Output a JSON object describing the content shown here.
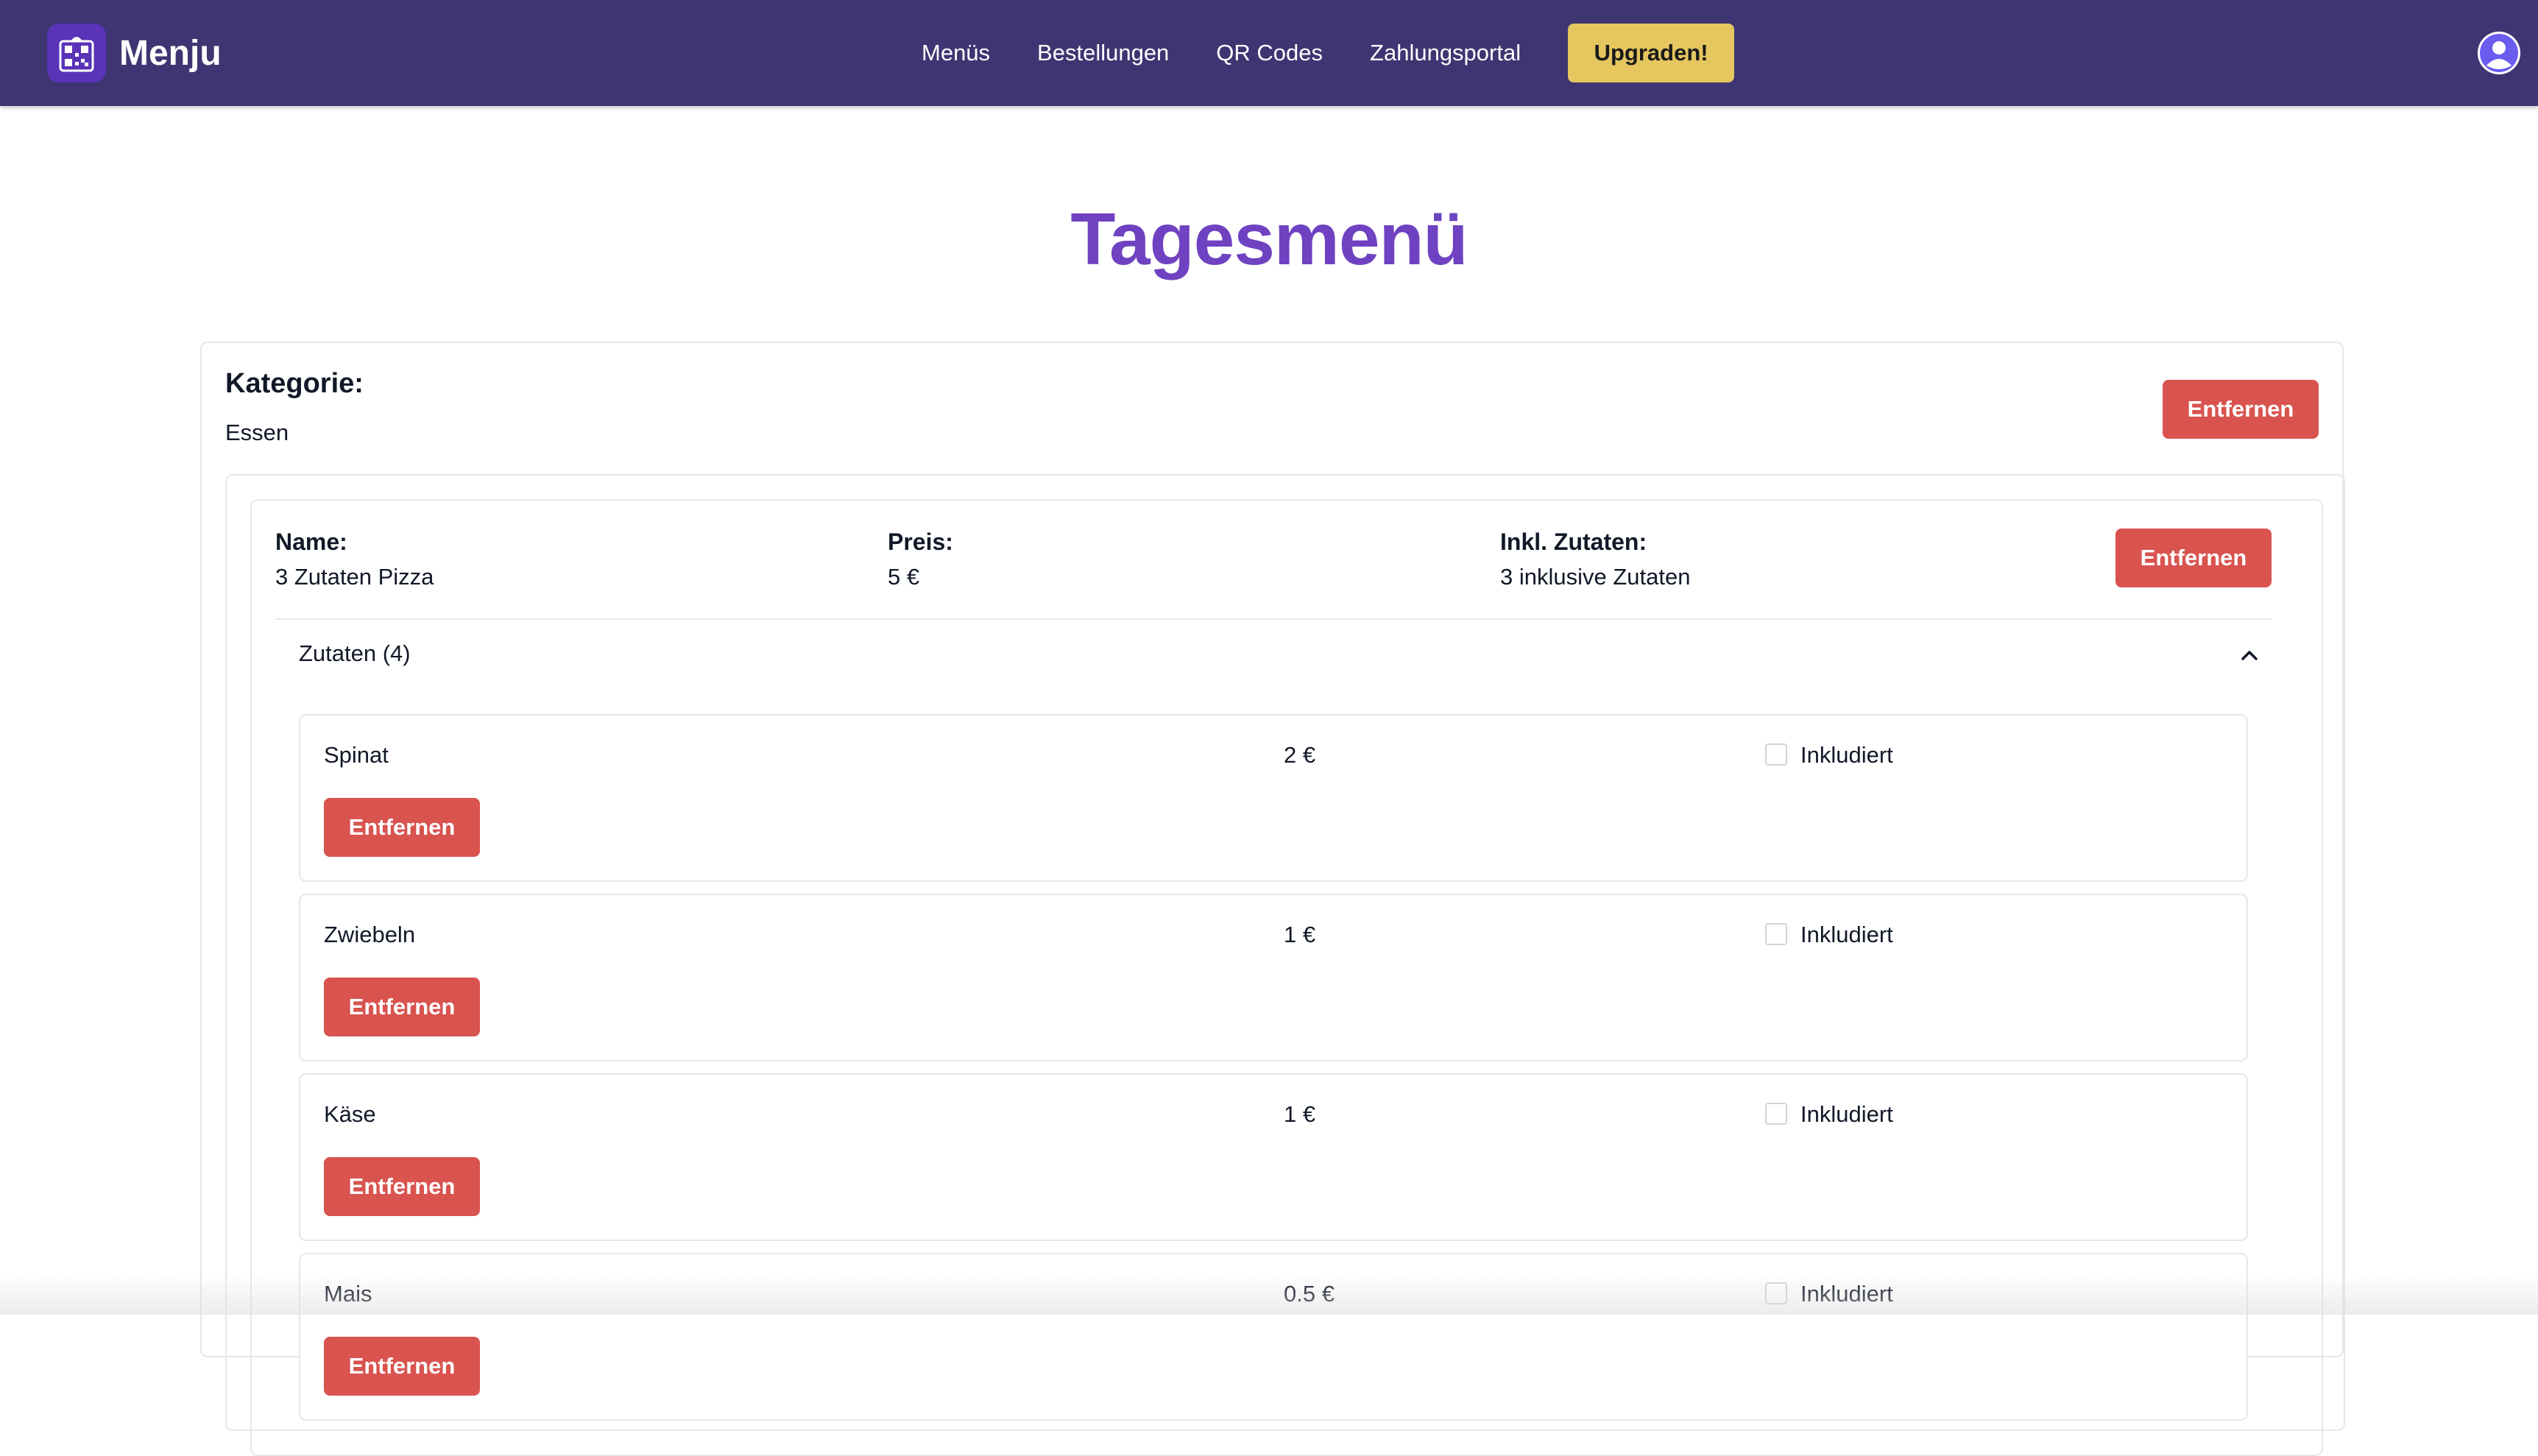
{
  "navbar": {
    "brand": "Menju",
    "links": [
      "Menüs",
      "Bestellungen",
      "QR Codes",
      "Zahlungsportal"
    ],
    "upgrade_label": "Upgraden!"
  },
  "page": {
    "title": "Tagesmenü"
  },
  "category": {
    "label": "Kategorie:",
    "value": "Essen",
    "remove_label": "Entfernen"
  },
  "item": {
    "name_label": "Name:",
    "name_value": "3 Zutaten Pizza",
    "price_label": "Preis:",
    "price_value": "5 €",
    "incl_label": "Inkl. Zutaten:",
    "incl_value": "3 inklusive Zutaten",
    "remove_label": "Entfernen",
    "ingredients_header": "Zutaten (4)",
    "ingredients": [
      {
        "name": "Spinat",
        "price": "2 €",
        "included_label": "Inkludiert",
        "included": false,
        "remove_label": "Entfernen"
      },
      {
        "name": "Zwiebeln",
        "price": "1 €",
        "included_label": "Inkludiert",
        "included": false,
        "remove_label": "Entfernen"
      },
      {
        "name": "Käse",
        "price": "1 €",
        "included_label": "Inkludiert",
        "included": false,
        "remove_label": "Entfernen"
      },
      {
        "name": "Mais",
        "price": "0.5 €",
        "included_label": "Inkludiert",
        "included": false,
        "remove_label": "Entfernen"
      }
    ]
  },
  "colors": {
    "navbar": "#3f3572",
    "accent": "#6f42c1",
    "upgrade": "#e6c65f",
    "danger": "#d9534f"
  }
}
